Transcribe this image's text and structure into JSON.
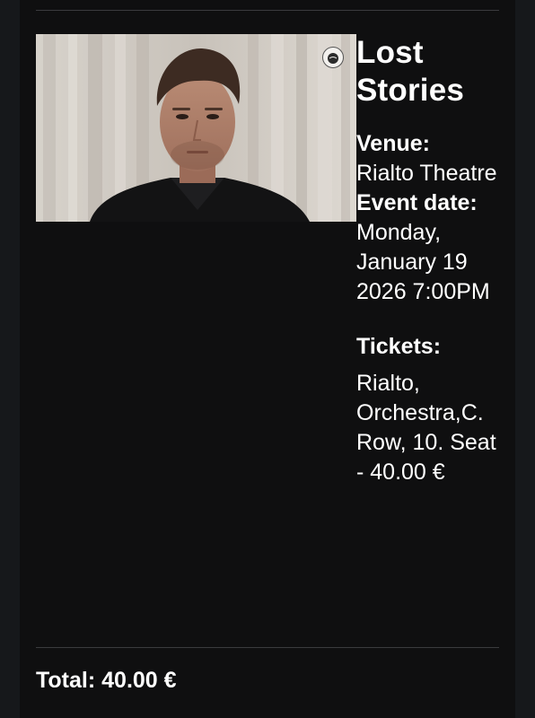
{
  "event": {
    "title": "Lost Stories",
    "venue_label": "Venue:",
    "venue": "Rialto Theatre",
    "date_label": "Event date:",
    "date": "Monday, January 19 2026 7:00PM",
    "tickets_label": "Tickets:",
    "tickets": "Rialto, Orchestra,C. Row, 10. Seat - 40.00 €"
  },
  "summary": {
    "total": "Total: 40.00 €"
  },
  "icons": {
    "photo_badge": "globe-logo-icon"
  },
  "colors": {
    "background": "#16181b",
    "card": "#0f0f10",
    "text": "#ffffff",
    "divider": "#3a3b3e"
  }
}
